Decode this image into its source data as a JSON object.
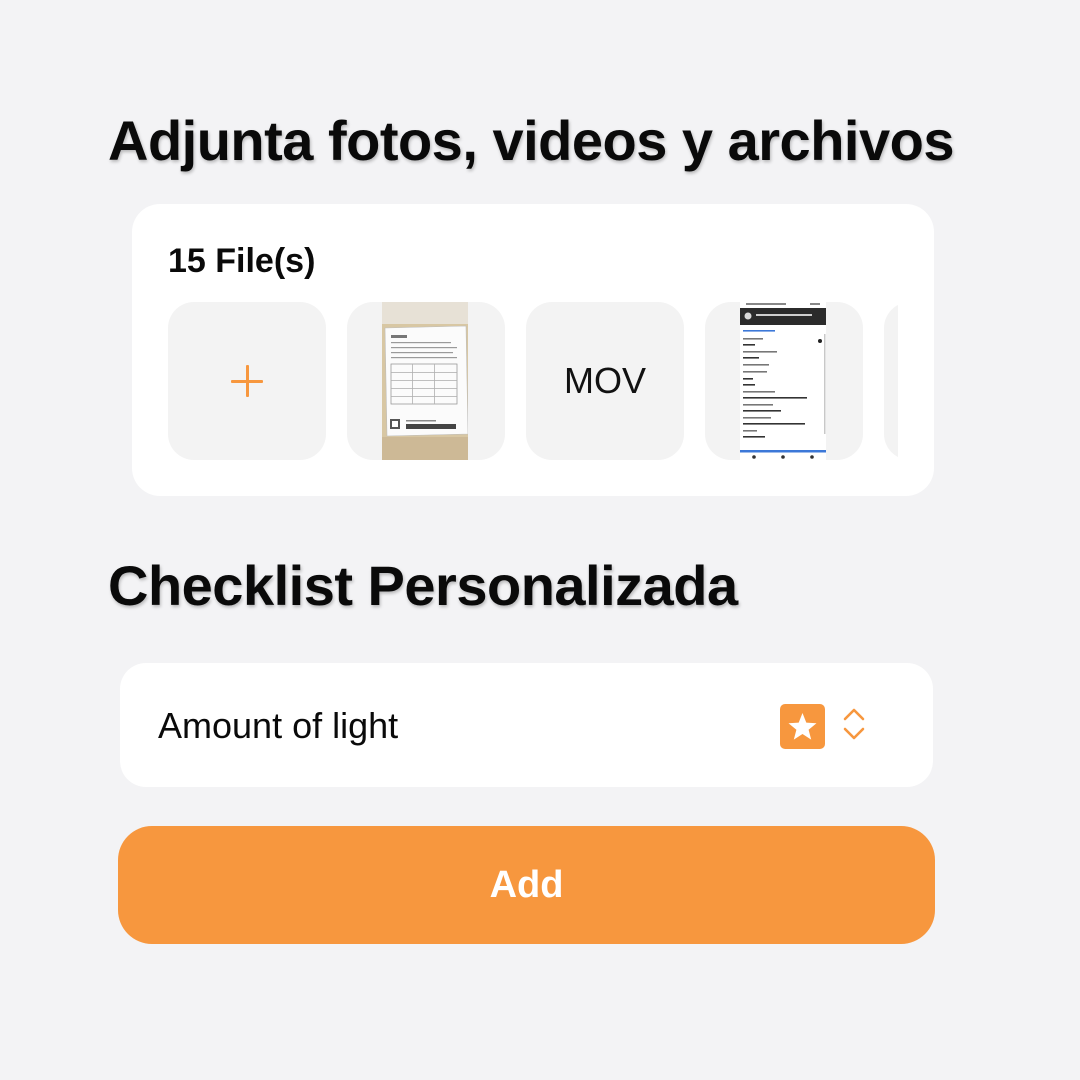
{
  "attachments": {
    "title": "Adjunta fotos, videos y archivos",
    "file_count_label": "15 File(s)",
    "thumbnails": [
      {
        "kind": "add",
        "icon": "plus-icon"
      },
      {
        "kind": "image",
        "description_icon": "document-photo-icon"
      },
      {
        "kind": "video",
        "label": "MOV"
      },
      {
        "kind": "image",
        "description_icon": "screenshot-icon"
      },
      {
        "kind": "partial"
      }
    ]
  },
  "checklist": {
    "title": "Checklist Personalizada",
    "item_label": "Amount of light",
    "item_icon": "star-icon",
    "selector_icon": "chevron-up-down-icon"
  },
  "actions": {
    "add_label": "Add"
  },
  "colors": {
    "accent": "#f7973e",
    "background": "#f3f3f5",
    "card": "#ffffff",
    "thumb_bg": "#f3f3f3"
  }
}
